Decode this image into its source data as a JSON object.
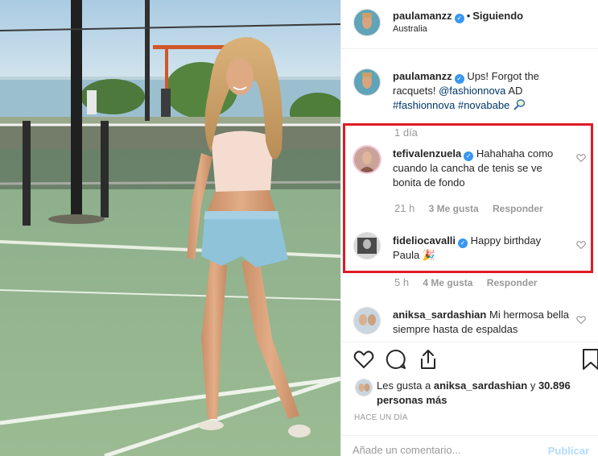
{
  "post": {
    "author": "paulamanzz",
    "follow_status": "Siguiendo",
    "dot": "•",
    "location": "Australia",
    "caption_text": "Ups! Forgot the racquets!",
    "caption_mention": "@fashionnova",
    "caption_ad": "AD",
    "caption_tag1": "#fashionnova",
    "caption_tag2": "#novababe",
    "caption_time": "1 día"
  },
  "comments": [
    {
      "user": "tefivalenzuela",
      "text": "Hahahaha como cuando la cancha de tenis se ve bonita de fondo",
      "time": "21 h",
      "likes": "3 Me gusta",
      "reply": "Responder"
    },
    {
      "user": "fideliocavalli",
      "text": "Happy birthday Paula",
      "emoji": "🎉",
      "time": "5 h",
      "likes": "4 Me gusta",
      "reply": "Responder"
    },
    {
      "user": "aniksa_sardashian",
      "text": "Mi hermosa bella siempre hasta de espaldas"
    }
  ],
  "likes": {
    "prefix": "Les gusta a",
    "user": "aniksa_sardashian",
    "middle": "y",
    "count": "30.896 personas más"
  },
  "timestamp": "HACE UN DÍA",
  "add_comment": {
    "placeholder": "Añade un comentario...",
    "post_label": "Publicar"
  },
  "icons": {
    "verified": "verified-badge-icon",
    "like": "heart-icon",
    "comment": "comment-bubble-icon",
    "share": "share-icon",
    "save": "bookmark-icon"
  },
  "colors": {
    "verified": "#3897f0",
    "link": "#003569",
    "muted": "#999999",
    "highlight": "#e01b24",
    "post_disabled": "#b3dbff"
  }
}
